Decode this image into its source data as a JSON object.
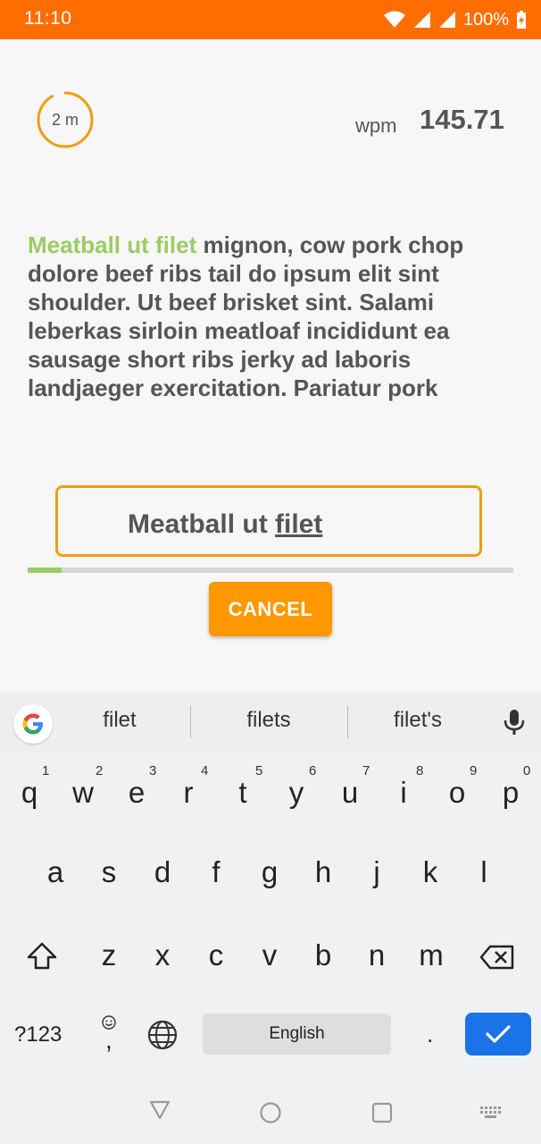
{
  "status": {
    "time": "11:10",
    "battery": "100%"
  },
  "timer": {
    "label": "2 m",
    "progress": 0.92,
    "color": "#f39c12"
  },
  "wpm": {
    "label": "wpm",
    "value": "145.71"
  },
  "passage": {
    "typed": "Meatball ut filet",
    "rest": " mignon, cow pork chop dolore beef ribs tail do ipsum elit sint shoulder. Ut beef brisket sint. Salami leberkas sirloin meatloaf incididunt ea sausage short ribs jerky ad laboris landjaeger exercitation. Pariatur pork"
  },
  "input": {
    "prefix": "Meatball ut ",
    "current_word": "filet"
  },
  "progress": {
    "fraction": 0.07
  },
  "cancel_label": "CANCEL",
  "keyboard": {
    "suggestions": [
      "filet",
      "filets",
      "filet's"
    ],
    "row1": [
      "q",
      "w",
      "e",
      "r",
      "t",
      "y",
      "u",
      "i",
      "o",
      "p"
    ],
    "row1_hints": [
      "1",
      "2",
      "3",
      "4",
      "5",
      "6",
      "7",
      "8",
      "9",
      "0"
    ],
    "row2": [
      "a",
      "s",
      "d",
      "f",
      "g",
      "h",
      "j",
      "k",
      "l"
    ],
    "row3": [
      "z",
      "x",
      "c",
      "v",
      "b",
      "n",
      "m"
    ],
    "symbols_label": "?123",
    "comma": ",",
    "space_label": "English",
    "period": "."
  },
  "colors": {
    "accent": "#ff6d00",
    "orange": "#ff9800",
    "green": "#9ccc65",
    "blue": "#1a73e8"
  }
}
